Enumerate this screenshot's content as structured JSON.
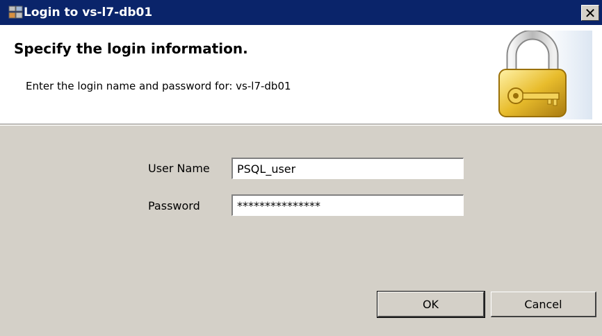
{
  "window": {
    "title": "Login to vs-l7-db01",
    "close_symbol": "✕",
    "app_icon": "server-app-icon",
    "close_icon": "close-icon"
  },
  "header": {
    "heading": "Specify the login information.",
    "subtext": "Enter the login name and password for: vs-l7-db01",
    "illustration": "padlock-key-icon"
  },
  "form": {
    "username_label": "User Name",
    "username_value": "PSQL_user",
    "password_label": "Password",
    "password_value": "***************"
  },
  "buttons": {
    "ok_label": "OK",
    "cancel_label": "Cancel"
  },
  "colors": {
    "titlebar": "#0a246a",
    "dialog_background": "#d4d0c8",
    "header_background": "#ffffff",
    "lock_gold": "#d9a826"
  }
}
